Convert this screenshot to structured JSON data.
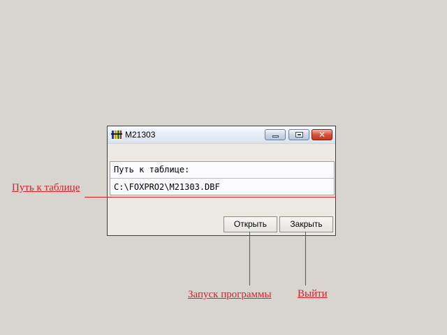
{
  "window": {
    "title": "M21303",
    "icon": "foxpro-app-icon",
    "controls": {
      "minimize": "minimize-icon",
      "maximize": "maximize-icon",
      "close": "close-icon",
      "close_glyph": "✕"
    }
  },
  "path_panel": {
    "label": "Путь к таблице:",
    "value": "C:\\FOXPRO2\\M21303.DBF"
  },
  "buttons": {
    "open_label": "Открыть",
    "close_label": "Закрыть"
  },
  "annotations": {
    "path": "Путь к таблице",
    "run": "Запуск программы",
    "exit": "Выйти",
    "color": "#d8202a"
  }
}
